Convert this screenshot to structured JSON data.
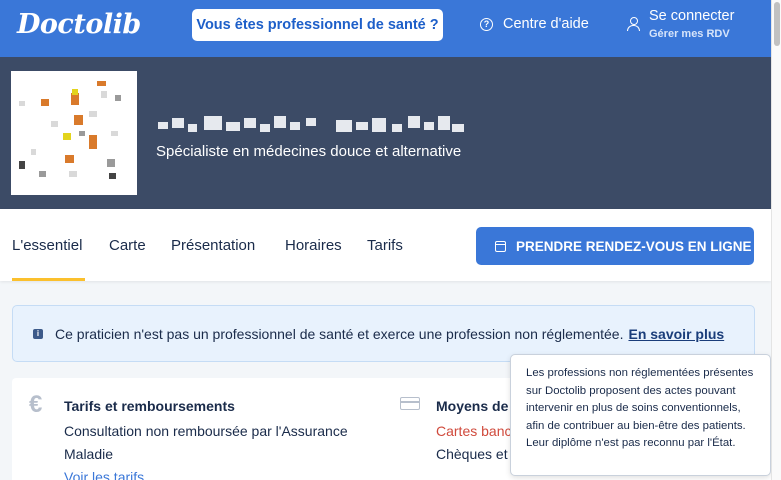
{
  "header": {
    "logo": "Doctolib",
    "pro_button": "Vous êtes professionnel de santé ?",
    "help": "Centre d'aide",
    "login": "Se connecter",
    "login_sub": "Gérer mes RDV"
  },
  "profile": {
    "specialty": "Spécialiste en médecines douce et alternative"
  },
  "tabs": {
    "items": [
      "L'essentiel",
      "Carte",
      "Présentation",
      "Horaires",
      "Tarifs"
    ],
    "cta": "PRENDRE RENDEZ-VOUS EN LIGNE"
  },
  "banner": {
    "text": "Ce praticien n'est pas un professionnel de santé et exerce une profession non réglementée.",
    "link": "En savoir plus"
  },
  "fees": {
    "title": "Tarifs et remboursements",
    "line1": "Consultation non remboursée par l'Assurance",
    "line2": "Maladie",
    "link": "Voir les tarifs"
  },
  "payment": {
    "title": "Moyens de p",
    "line1": "Cartes banc",
    "line2": "Chèques et e"
  },
  "tooltip": {
    "text": "Les professions non réglementées présentes sur Doctolib proposent des actes pouvant intervenir en plus de soins conventionnels, afin de contribuer au bien-être des patients. Leur diplôme n'est pas reconnu par l'État."
  },
  "colors": {
    "brand_blue": "#3a77d8",
    "profile_bg": "#3c4b66",
    "tab_underline": "#fbc02d",
    "payment_red": "#d04a3c"
  },
  "icons": [
    "help-circle-icon",
    "user-icon",
    "calendar-icon",
    "info-icon",
    "euro-icon",
    "credit-card-icon"
  ]
}
